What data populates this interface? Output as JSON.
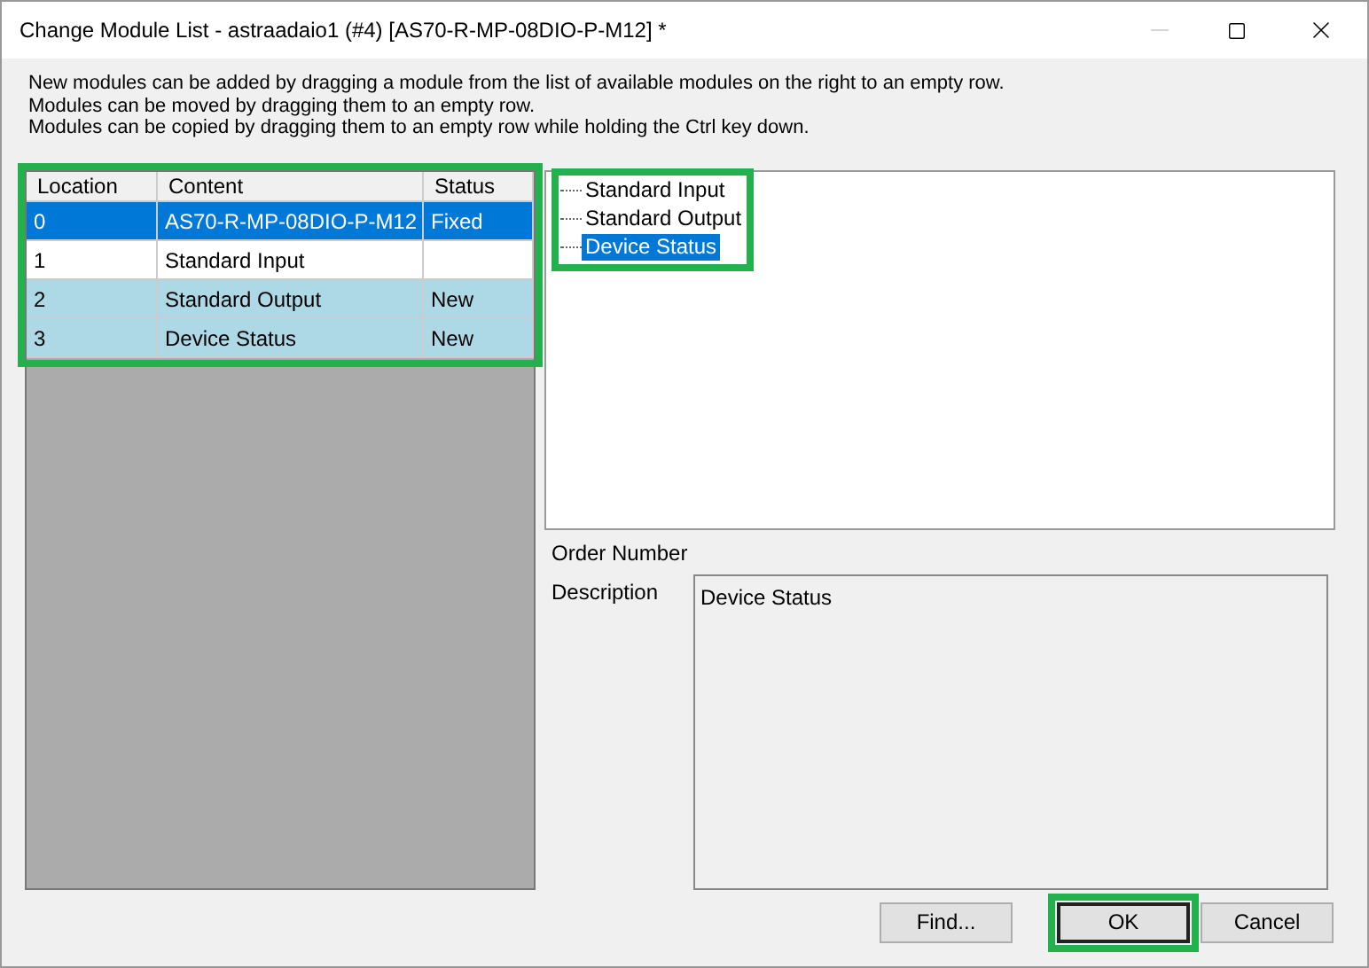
{
  "window": {
    "title": "Change Module List - astraadaio1 (#4) [AS70-R-MP-08DIO-P-M12] *",
    "minimize_disabled": true
  },
  "instructions": [
    "New modules can be added by dragging a module from the list of available modules on the right to an empty row.",
    "Modules can be moved by dragging them to an empty row.",
    "Modules can be copied by dragging them to an empty row while holding the Ctrl key down."
  ],
  "table": {
    "highlighted": true,
    "columns": [
      "Location",
      "Content",
      "Status"
    ],
    "rows": [
      {
        "cells": [
          "0",
          "AS70-R-MP-08DIO-P-M12",
          "Fixed"
        ],
        "selected": true
      },
      {
        "cells": [
          "1",
          "Standard Input",
          ""
        ],
        "selected": false,
        "kind": "existing"
      },
      {
        "cells": [
          "2",
          "Standard Output",
          "New"
        ],
        "selected": false,
        "kind": "new"
      },
      {
        "cells": [
          "3",
          "Device Status",
          "New"
        ],
        "selected": false,
        "kind": "new"
      }
    ]
  },
  "tree": {
    "highlighted": true,
    "items": [
      {
        "label": "Standard Input",
        "selected": false
      },
      {
        "label": "Standard Output",
        "selected": false
      },
      {
        "label": "Device Status",
        "selected": true
      }
    ]
  },
  "order_number": {
    "label": "Order Number"
  },
  "description": {
    "label": "Description",
    "value": "Device Status"
  },
  "buttons": [
    {
      "label": "Find...",
      "default": false,
      "highlighted": false
    },
    {
      "label": "OK",
      "default": true,
      "highlighted": true
    },
    {
      "label": "Cancel",
      "default": false,
      "highlighted": false
    }
  ]
}
